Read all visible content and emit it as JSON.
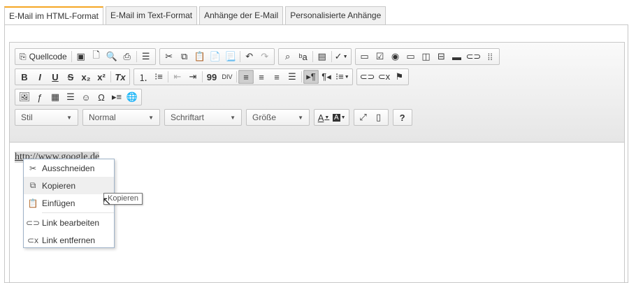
{
  "tabs": [
    {
      "label": "E-Mail im HTML-Format"
    },
    {
      "label": "E-Mail im Text-Format"
    },
    {
      "label": "Anhänge der E-Mail"
    },
    {
      "label": "Personalisierte Anhänge"
    }
  ],
  "toolbar": {
    "source_label": "Quellcode",
    "bold": "B",
    "italic": "I",
    "underline": "U",
    "strike": "S",
    "subscript": "x₂",
    "superscript": "x²",
    "remove_format": "Tx",
    "quote": "99",
    "help": "?"
  },
  "combos": {
    "style": "Stil",
    "format": "Normal",
    "font": "Schriftart",
    "size": "Größe"
  },
  "content": {
    "link_text": "http://www.google.de"
  },
  "context_menu": {
    "items": [
      {
        "label": "Ausschneiden"
      },
      {
        "label": "Kopieren"
      },
      {
        "label": "Einfügen"
      },
      {
        "label": "Link bearbeiten"
      },
      {
        "label": "Link entfernen"
      }
    ]
  },
  "tooltip": "Kopieren",
  "colors": {
    "active_tab_accent": "#f5a623",
    "toolbar_bg": "#e6e6e6",
    "selection_bg": "#d6d6d6"
  }
}
